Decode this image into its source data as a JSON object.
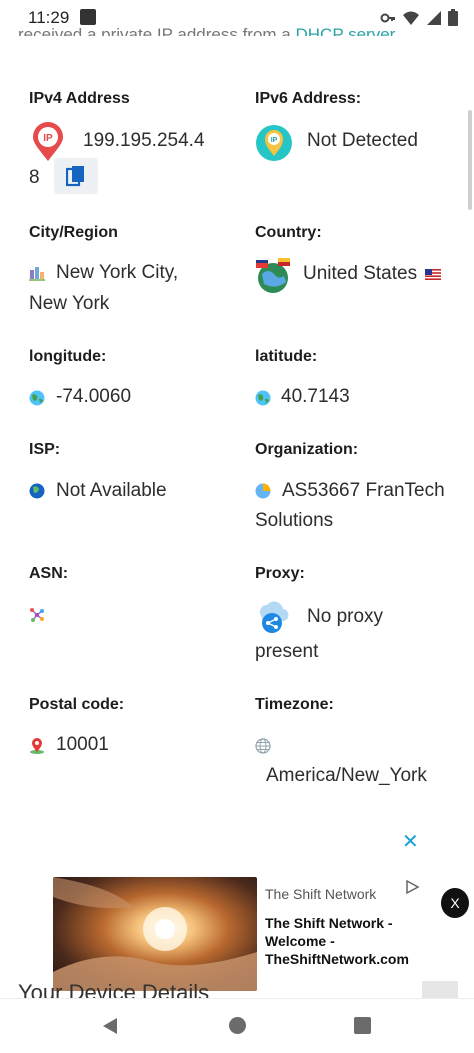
{
  "status_bar": {
    "time": "11:29"
  },
  "intro": {
    "text": "received a private IP address from a ",
    "link": "DHCP server."
  },
  "fields": {
    "ipv4": {
      "label": "IPv4 Address",
      "value_line1": "199.195.254.4",
      "value_line2": "8"
    },
    "ipv6": {
      "label": "IPv6 Address:",
      "value": "Not Detected"
    },
    "city": {
      "label": "City/Region",
      "value_line1": "New York City,",
      "value_line2": "New York"
    },
    "country": {
      "label": "Country:",
      "value": "United States"
    },
    "longitude": {
      "label": "longitude:",
      "value": "-74.0060"
    },
    "latitude": {
      "label": "latitude:",
      "value": "40.7143"
    },
    "isp": {
      "label": "ISP:",
      "value": "Not Available"
    },
    "organization": {
      "label": "Organization:",
      "value_line1": "AS53667 FranTech",
      "value_line2": "Solutions"
    },
    "asn": {
      "label": "ASN:",
      "value": ""
    },
    "proxy": {
      "label": "Proxy:",
      "value_line1": "No proxy",
      "value_line2": "present"
    },
    "postal": {
      "label": "Postal code:",
      "value": "10001"
    },
    "timezone": {
      "label": "Timezone:",
      "value": "America/New_York"
    }
  },
  "ad": {
    "brand": "The Shift Network",
    "headline": "The Shift Network - Welcome - TheShiftNetwork.com",
    "close_x": "✕",
    "dismiss": "X"
  },
  "section_heading": "Your Device Details",
  "colors": {
    "accent": "#1a9fd6",
    "link": "#2aa3a8",
    "copy_icon": "#1565c0"
  }
}
